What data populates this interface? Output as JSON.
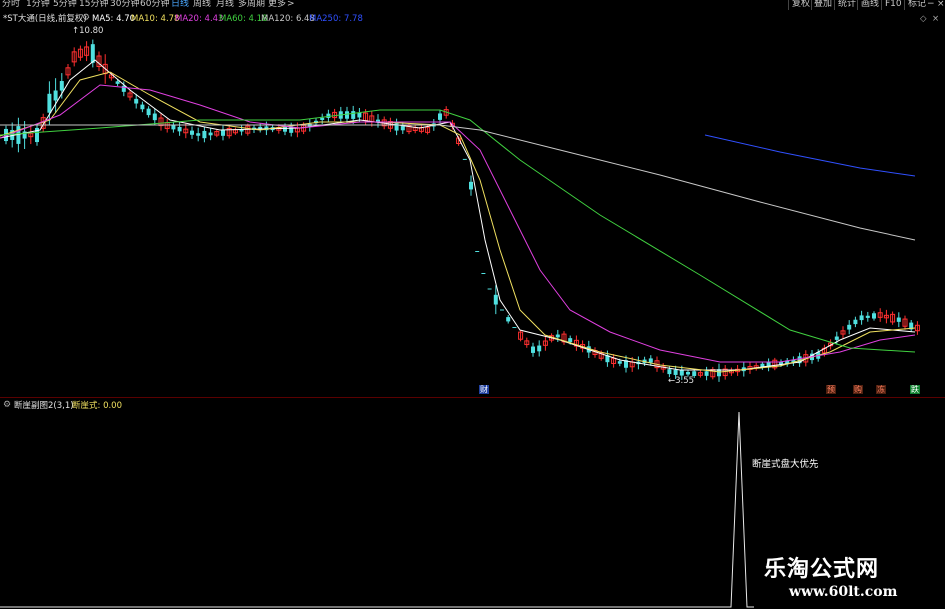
{
  "toolbar": {
    "periods": [
      "分时",
      "1分钟",
      "5分钟",
      "15分钟",
      "30分钟",
      "60分钟",
      "日线",
      "周线",
      "月线",
      "多周期",
      "更多"
    ],
    "active_period": "日线",
    "more_chevron": ">",
    "right_buttons": [
      "复权",
      "叠加",
      "统计",
      "画线",
      "F10",
      "标记"
    ],
    "min_icon": "−",
    "close_icon": "×"
  },
  "price_panel": {
    "title": "*ST大通(日线,前复权)",
    "ma_items": [
      {
        "label": "MA5: 4.70",
        "color": "#ffffff"
      },
      {
        "label": "MA10: 4.78",
        "color": "#f0e060"
      },
      {
        "label": "MA20: 4.43",
        "color": "#e040e0"
      },
      {
        "label": "MA60: 4.18",
        "color": "#40d040"
      },
      {
        "label": "MA120: 6.48",
        "color": "#c8c8c8"
      },
      {
        "label": "MA250: 7.78",
        "color": "#3050ff"
      }
    ],
    "high_label": "10.80",
    "low_label": "3.55",
    "event_tags": [
      {
        "text": "财",
        "color": "#ffffff",
        "bg": "#2040a0"
      },
      {
        "text": "预",
        "color": "#ff8060",
        "bg": "#502010"
      },
      {
        "text": "购",
        "color": "#ff8060",
        "bg": "#502010"
      },
      {
        "text": "冻",
        "color": "#ff8060",
        "bg": "#502010"
      },
      {
        "text": "跌",
        "color": "#ffffff",
        "bg": "#108030"
      }
    ]
  },
  "indicator_panel": {
    "title": "断崖副图2(3,1)",
    "value_label": "断崖式: 0.00",
    "annotation": "断崖式盘大优先"
  },
  "watermark": {
    "title": "乐淘公式网",
    "url": "www.60lt.com"
  },
  "colors": {
    "up": "#ff3030",
    "down": "#50e0e0",
    "ma5": "#ffffff",
    "ma10": "#f0e060",
    "ma20": "#e040e0",
    "ma60": "#40d040",
    "ma120": "#c8c8c8",
    "ma250": "#3050ff"
  }
}
